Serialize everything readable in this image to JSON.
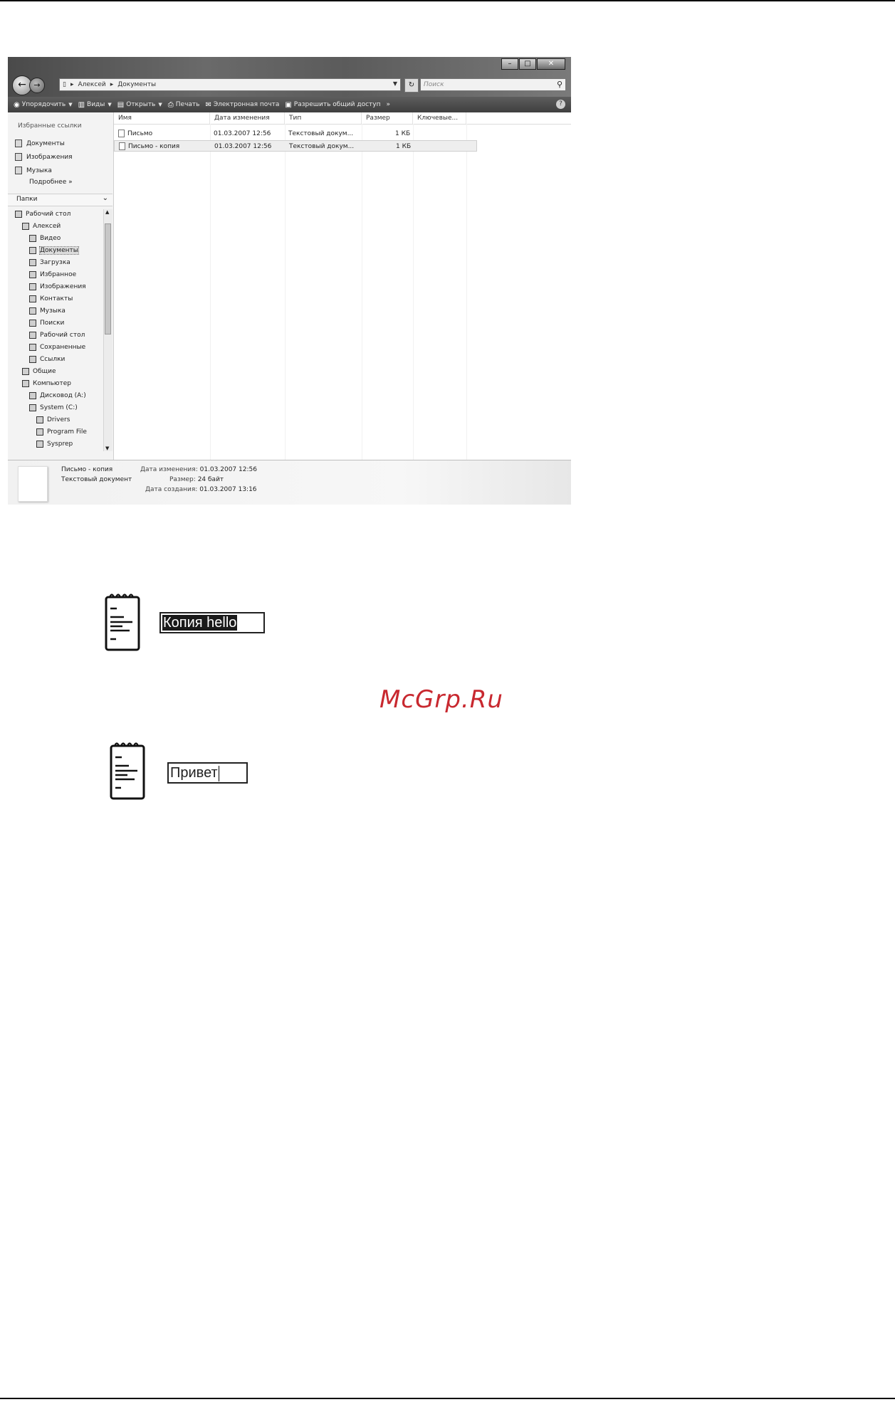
{
  "window": {
    "address": [
      "Алексей",
      "Документы"
    ],
    "search_placeholder": "Поиск",
    "toolbar": [
      "Упорядочить",
      "Виды",
      "Открыть",
      "Печать",
      "Электронная почта",
      "Разрешить общий доступ"
    ],
    "more_symbol": "»",
    "help_symbol": "?"
  },
  "nav": {
    "favorites_title": "Избранные ссылки",
    "favorites": [
      "Документы",
      "Изображения",
      "Музыка"
    ],
    "more": "Подробнее »",
    "folders_title": "Папки",
    "tree": [
      {
        "label": "Рабочий стол",
        "depth": 0
      },
      {
        "label": "Алексей",
        "depth": 1
      },
      {
        "label": "Видео",
        "depth": 2
      },
      {
        "label": "Документы",
        "depth": 2,
        "selected": true
      },
      {
        "label": "Загрузка",
        "depth": 2
      },
      {
        "label": "Избранное",
        "depth": 2
      },
      {
        "label": "Изображения",
        "depth": 2
      },
      {
        "label": "Контакты",
        "depth": 2
      },
      {
        "label": "Музыка",
        "depth": 2
      },
      {
        "label": "Поиски",
        "depth": 2
      },
      {
        "label": "Рабочий стол",
        "depth": 2
      },
      {
        "label": "Сохраненные",
        "depth": 2
      },
      {
        "label": "Ссылки",
        "depth": 2
      },
      {
        "label": "Общие",
        "depth": 1
      },
      {
        "label": "Компьютер",
        "depth": 1
      },
      {
        "label": "Дисковод (A:)",
        "depth": 2
      },
      {
        "label": "System (C:)",
        "depth": 2
      },
      {
        "label": "Drivers",
        "depth": 3
      },
      {
        "label": "Program File",
        "depth": 3
      },
      {
        "label": "Sysprep",
        "depth": 3
      }
    ]
  },
  "list": {
    "columns": [
      "Имя",
      "Дата изменения",
      "Тип",
      "Размер",
      "Ключевые..."
    ],
    "rows": [
      {
        "name": "Письмо",
        "date": "01.03.2007 12:56",
        "type": "Текстовый докум...",
        "size": "1 КБ",
        "selected": false
      },
      {
        "name": "Письмо - копия",
        "date": "01.03.2007 12:56",
        "type": "Текстовый докум...",
        "size": "1 КБ",
        "selected": true
      }
    ]
  },
  "details": {
    "name": "Письмо - копия",
    "type": "Текстовый документ",
    "modified_label": "Дата изменения:",
    "modified_value": "01.03.2007 12:56",
    "size_label": "Размер:",
    "size_value": "24 байт",
    "created_label": "Дата создания:",
    "created_value": "01.03.2007 13:16"
  },
  "notepad1": {
    "text": "Копия hello"
  },
  "notepad2": {
    "text": "Привет"
  },
  "watermark": "McGrp.Ru"
}
